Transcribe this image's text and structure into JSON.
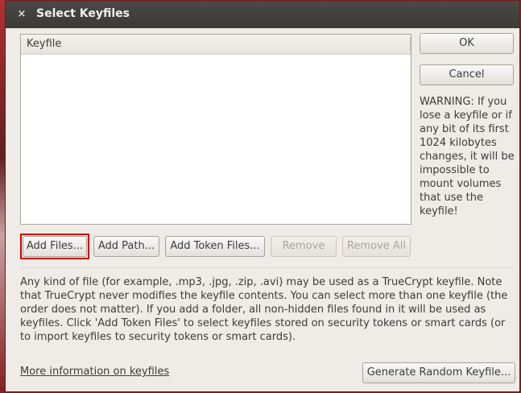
{
  "window": {
    "title": "Select Keyfiles",
    "close_glyph": "×"
  },
  "list": {
    "column_header": "Keyfile",
    "rows": []
  },
  "buttons": {
    "ok": "OK",
    "cancel": "Cancel",
    "add_files": "Add Files...",
    "add_path": "Add Path...",
    "add_token_files": "Add Token Files...",
    "remove": "Remove",
    "remove_all": "Remove All",
    "generate_random": "Generate Random Keyfile..."
  },
  "warning_text": "WARNING: If you lose a keyfile or if any bit of its first 1024 kilobytes changes, it will be impossible to mount volumes that use the keyfile!",
  "info_text": "Any kind of file (for example, .mp3, .jpg, .zip, .avi) may be used as a TrueCrypt keyfile. Note that TrueCrypt never modifies the keyfile contents. You can select more than one keyfile (the order does not matter). If you add a folder, all non-hidden files found in it will be used as keyfiles. Click 'Add Token Files' to select keyfiles stored on security tokens or smart cards (or to import keyfiles to security tokens or smart cards).",
  "more_info_link": "More information on keyfiles",
  "state": {
    "remove_enabled": false,
    "remove_all_enabled": false,
    "focused_button": "add_files"
  }
}
